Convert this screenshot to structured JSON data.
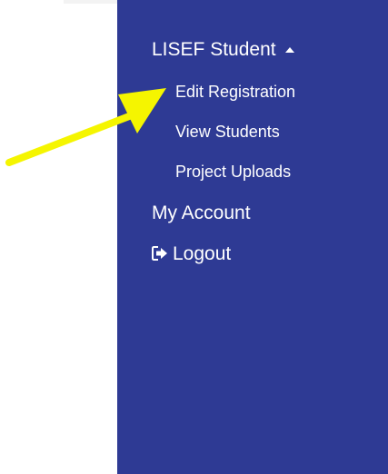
{
  "sidebar": {
    "section_label": "LISEF Student",
    "section_caret_icon": "caret-up-icon",
    "sub_items": [
      {
        "label": "Edit Registration"
      },
      {
        "label": "View Students"
      },
      {
        "label": "Project Uploads"
      }
    ],
    "my_account_label": "My Account",
    "logout_label": "Logout",
    "logout_icon": "logout-icon"
  },
  "annotation": {
    "arrow_icon": "pointer-arrow-icon",
    "arrow_color": "#f5f500"
  },
  "colors": {
    "sidebar_bg": "#2e3a94",
    "text": "#ffffff"
  }
}
